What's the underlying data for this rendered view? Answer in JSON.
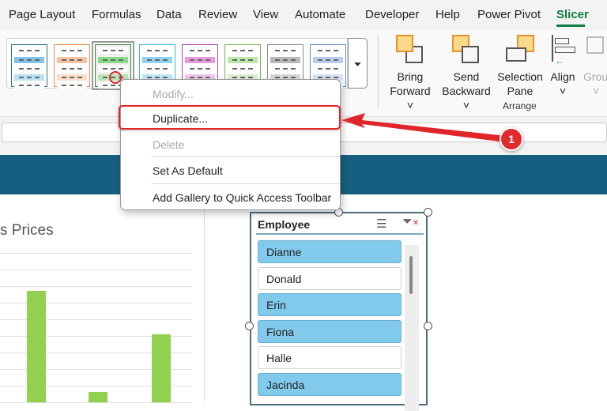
{
  "tabs": [
    "Page Layout",
    "Formulas",
    "Data",
    "Review",
    "View",
    "Automate",
    "Developer",
    "Help",
    "Power Pivot",
    "Slicer"
  ],
  "active_tab": "Slicer",
  "gallery": {
    "styles": [
      {
        "color": "#2e6f93",
        "fill": "#7fc4e6"
      },
      {
        "color": "#f08a4b",
        "fill": "#f8c3a2"
      },
      {
        "color": "#3c8a3c",
        "fill": "#86dc86"
      },
      {
        "color": "#45b4e0",
        "fill": "#8fd3f2"
      },
      {
        "color": "#b340b0",
        "fill": "#e59ae0"
      },
      {
        "color": "#6cbb4e",
        "fill": "#bde7aa"
      },
      {
        "color": "#8a8a8a",
        "fill": "#b8b8b8"
      },
      {
        "color": "#5b8bcd",
        "fill": "#b7cdef"
      }
    ],
    "more_icon": "chevron-more"
  },
  "ribbon": {
    "bring_forward": [
      "Bring",
      "Forward ˅"
    ],
    "send_backward": [
      "Send",
      "Backward ˅"
    ],
    "selection_pane": [
      "Selection",
      "Pane"
    ],
    "align": [
      "Align",
      "˅"
    ],
    "group": [
      "Grou",
      "˅"
    ],
    "arrange_label": "Arrange"
  },
  "context_menu": {
    "modify": "Modify...",
    "duplicate": "Duplicate...",
    "delete": "Delete",
    "set_default": "Set As Default",
    "add_gallery": "Add Gallery to Quick Access Toolbar"
  },
  "annotation": {
    "badge": "1",
    "color": "#e0262b"
  },
  "chart_data": {
    "type": "bar",
    "title": "s Prices",
    "values": [
      6.7,
      0.6,
      4.1
    ],
    "color": "#92d050",
    "ylim": [
      0,
      9
    ]
  },
  "slicer": {
    "title": "Employee",
    "items": [
      {
        "label": "Dianne",
        "selected": true
      },
      {
        "label": "Donald",
        "selected": false
      },
      {
        "label": "Erin",
        "selected": true
      },
      {
        "label": "Fiona",
        "selected": true
      },
      {
        "label": "Halle",
        "selected": false
      },
      {
        "label": "Jacinda",
        "selected": true
      }
    ]
  }
}
